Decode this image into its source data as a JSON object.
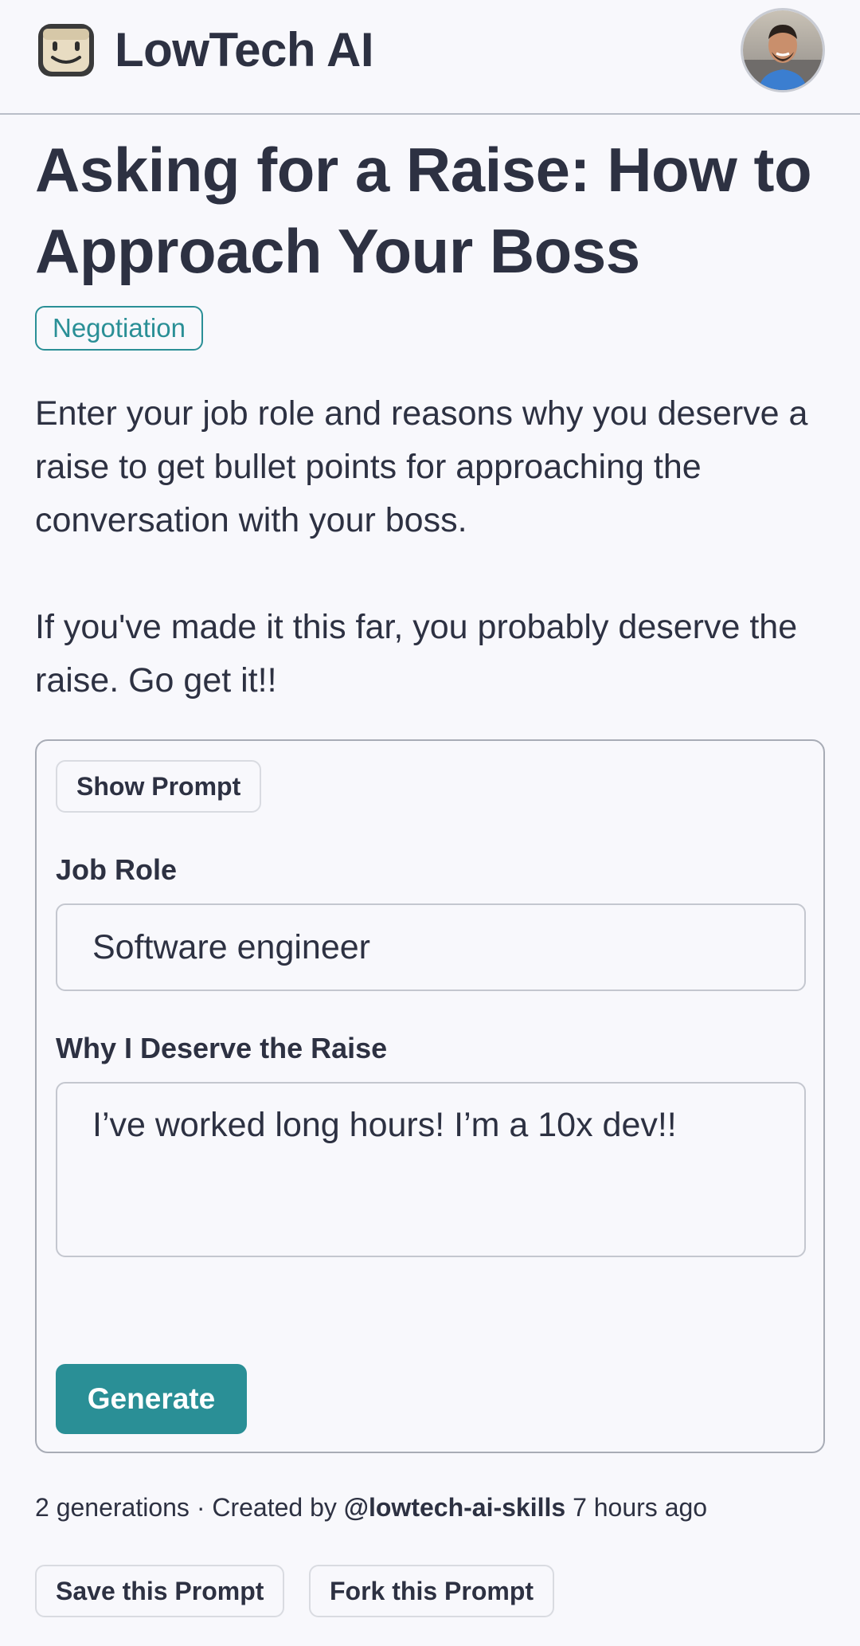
{
  "header": {
    "app_title": "LowTech AI",
    "logo_icon": "smiley-robot-icon",
    "avatar_icon": "user-avatar"
  },
  "page": {
    "title": "Asking for a Raise: How to Approach Your Boss",
    "tag": "Negotiation",
    "description": "Enter your job role and reasons why you deserve a raise to get bullet points for approaching the conversation with your boss.\n\nIf you've made it this far, you probably deserve the raise. Go get it!!"
  },
  "form": {
    "show_prompt_label": "Show Prompt",
    "job_role_label": "Job Role",
    "job_role_value": "Software engineer",
    "reason_label": "Why I Deserve the Raise",
    "reason_value": "I’ve worked long hours! I’m a 10x dev!!",
    "generate_label": "Generate"
  },
  "meta": {
    "generations": "2 generations",
    "separator": " · ",
    "created_by_prefix": "Created by ",
    "author": "@lowtech-ai-skills",
    "time_ago": " 7 hours ago"
  },
  "footer": {
    "save_label": "Save this Prompt",
    "fork_label": "Fork this Prompt"
  },
  "colors": {
    "accent": "#2a8f96",
    "text": "#2d3142",
    "background": "#f8f8fc"
  }
}
